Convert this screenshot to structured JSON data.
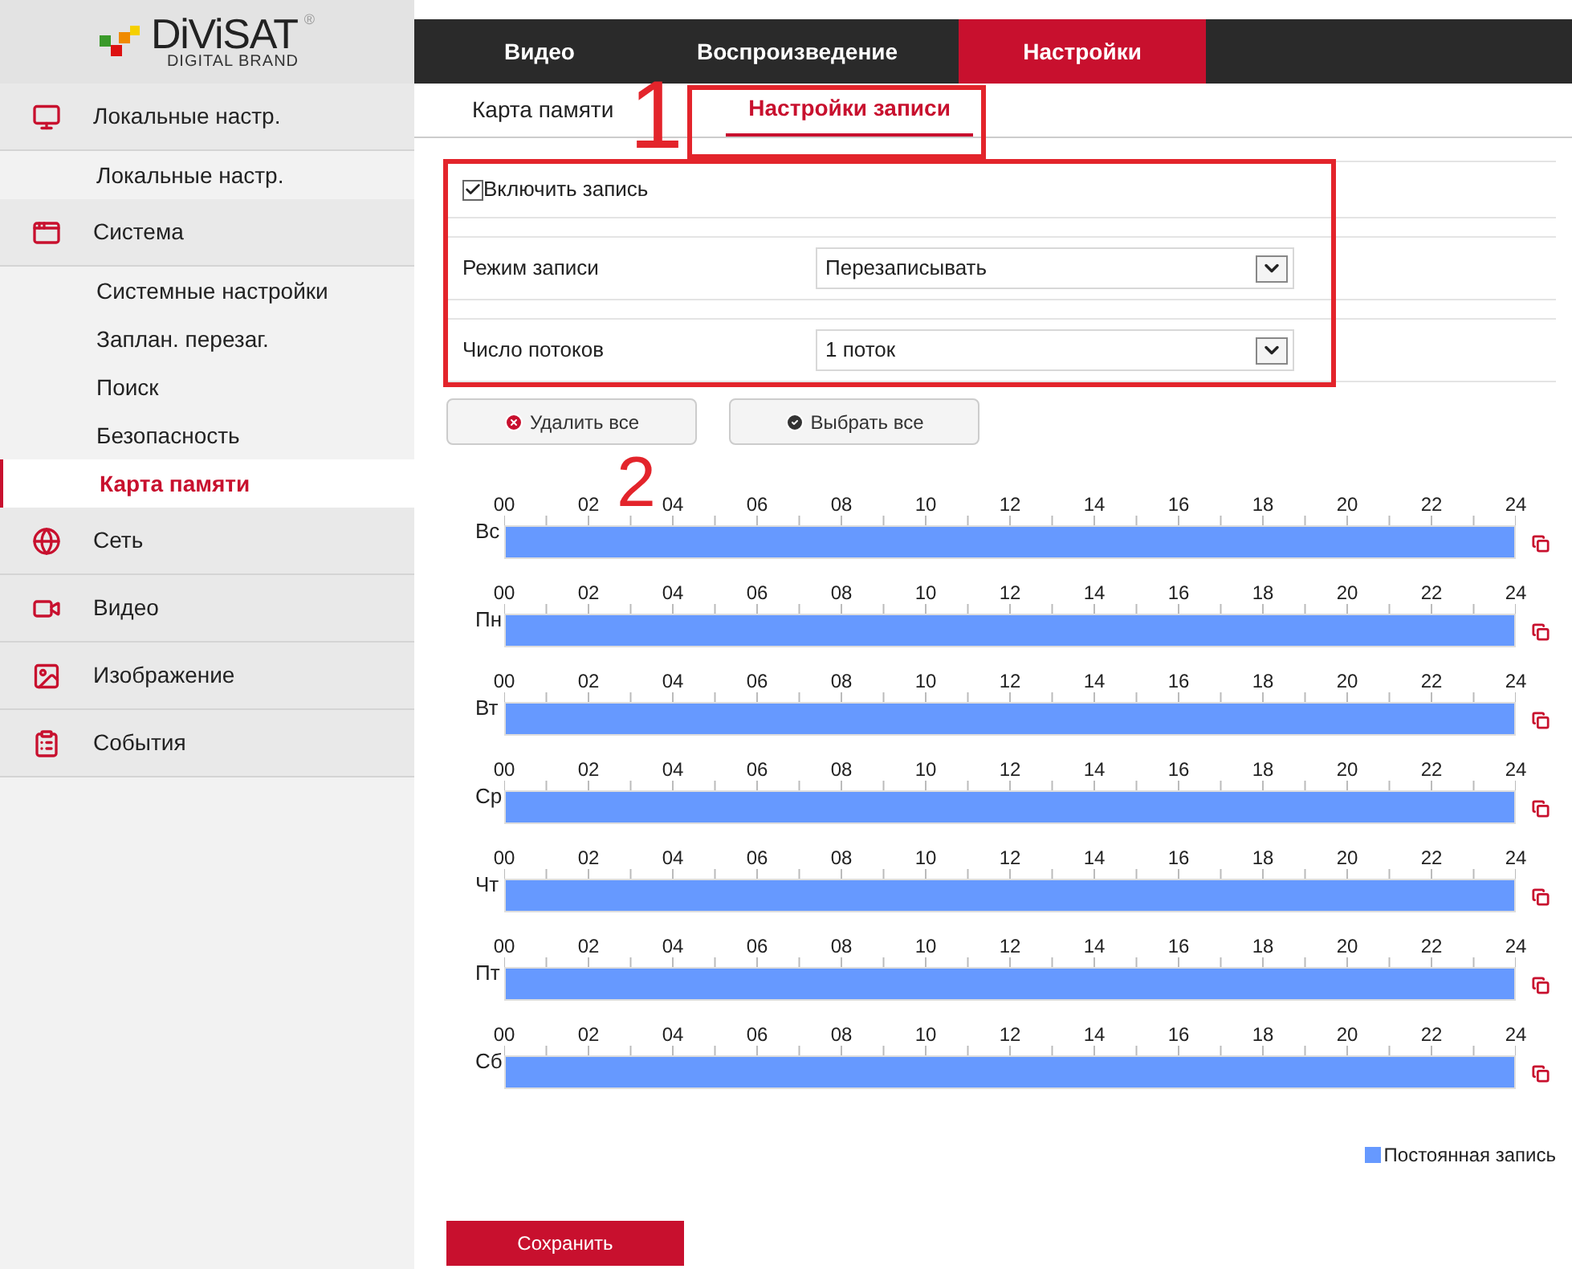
{
  "logo": {
    "name": "DiViSAT",
    "tagline": "DIGITAL BRAND",
    "mark": "®"
  },
  "top_nav": [
    {
      "label": "Видео",
      "selected": false
    },
    {
      "label": "Воспроизведение",
      "selected": false
    },
    {
      "label": "Настройки",
      "selected": true
    }
  ],
  "sidebar": [
    {
      "label": "Локальные настр.",
      "children": [
        {
          "label": "Локальные настр.",
          "selected": false
        }
      ]
    },
    {
      "label": "Система",
      "children": [
        {
          "label": "Системные настройки",
          "selected": false
        },
        {
          "label": "Заплан. перезаг.",
          "selected": false
        },
        {
          "label": "Поиск",
          "selected": false
        },
        {
          "label": "Безопасность",
          "selected": false
        },
        {
          "label": "Карта памяти",
          "selected": true
        }
      ]
    },
    {
      "label": "Сеть"
    },
    {
      "label": "Видео"
    },
    {
      "label": "Изображение"
    },
    {
      "label": "События"
    }
  ],
  "sub_tabs": [
    {
      "label": "Карта памяти",
      "selected": false
    },
    {
      "label": "Настройки записи",
      "selected": true
    }
  ],
  "enable_recording": {
    "label": "Включить запись",
    "checked": true
  },
  "fields": [
    {
      "label": "Режим записи",
      "value": "Перезаписывать"
    },
    {
      "label": "Число потоков",
      "value": "1 поток"
    }
  ],
  "buttons": [
    {
      "label": "Удалить все",
      "kind": "delete"
    },
    {
      "label": "Выбрать все",
      "kind": "select"
    }
  ],
  "schedule": [
    {
      "day": "Вс",
      "hours": [
        "00",
        "02",
        "04",
        "06",
        "08",
        "10",
        "12",
        "14",
        "16",
        "18",
        "20",
        "22",
        "24"
      ],
      "level": 1
    },
    {
      "day": "Пн",
      "hours": [
        "00",
        "02",
        "04",
        "06",
        "08",
        "10",
        "12",
        "14",
        "16",
        "18",
        "20",
        "22",
        "24"
      ],
      "level": 1
    },
    {
      "day": "Вт",
      "hours": [
        "00",
        "02",
        "04",
        "06",
        "08",
        "10",
        "12",
        "14",
        "16",
        "18",
        "20",
        "22",
        "24"
      ],
      "level": 1
    },
    {
      "day": "Ср",
      "hours": [
        "00",
        "02",
        "04",
        "06",
        "08",
        "10",
        "12",
        "14",
        "16",
        "18",
        "20",
        "22",
        "24"
      ],
      "level": 1
    },
    {
      "day": "Чт",
      "hours": [
        "00",
        "02",
        "04",
        "06",
        "08",
        "10",
        "12",
        "14",
        "16",
        "18",
        "20",
        "22",
        "24"
      ],
      "level": 1
    },
    {
      "day": "Пт",
      "hours": [
        "00",
        "02",
        "04",
        "06",
        "08",
        "10",
        "12",
        "14",
        "16",
        "18",
        "20",
        "22",
        "24"
      ],
      "level": 1
    },
    {
      "day": "Сб",
      "hours": [
        "00",
        "02",
        "04",
        "06",
        "08",
        "10",
        "12",
        "14",
        "16",
        "18",
        "20",
        "22",
        "24"
      ],
      "level": 1
    }
  ],
  "legend": {
    "label": "Постоянная запись",
    "color": "#6699ff"
  },
  "save_button": "Сохранить",
  "annotations": [
    "1",
    "2"
  ]
}
